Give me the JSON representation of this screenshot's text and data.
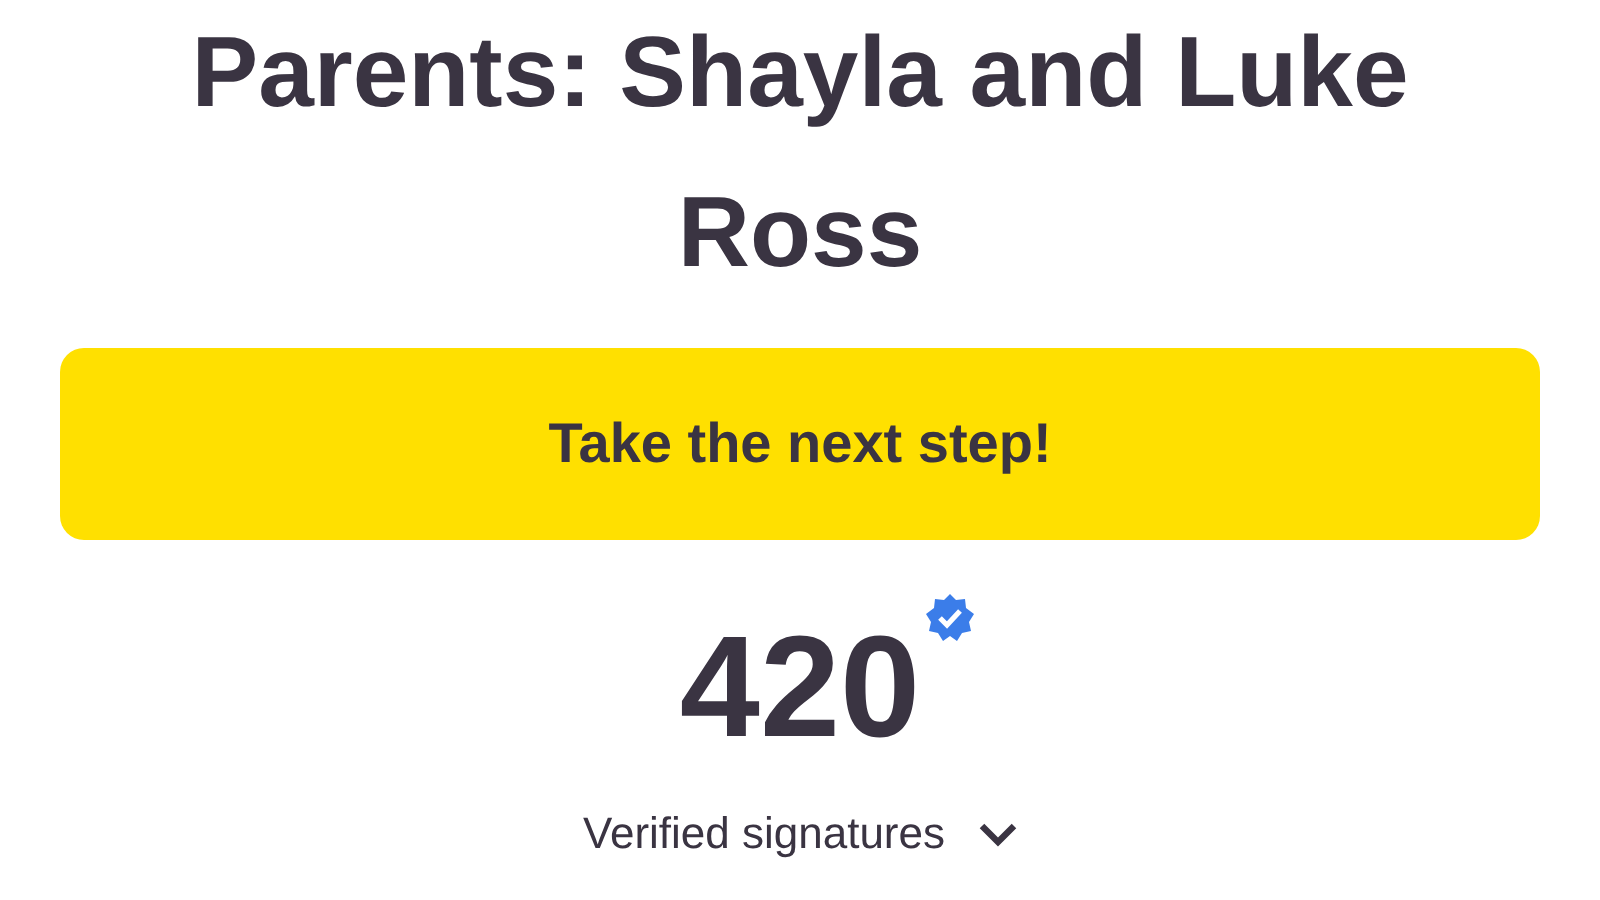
{
  "title": "Parents: Shayla and Luke Ross",
  "cta_button": {
    "label": "Take the next step!"
  },
  "signatures": {
    "count": "420",
    "verified": true,
    "label": "Verified signatures",
    "expanded": false
  }
}
